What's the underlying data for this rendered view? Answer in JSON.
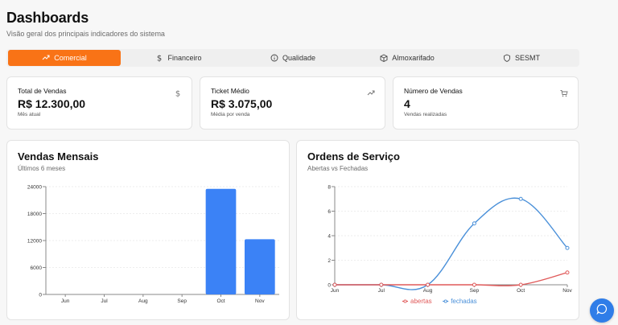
{
  "page": {
    "title": "Dashboards",
    "subtitle": "Visão geral dos principais indicadores do sistema"
  },
  "tabs": [
    {
      "label": "Comercial",
      "icon": "trend-up-icon",
      "active": true
    },
    {
      "label": "Financeiro",
      "icon": "dollar-icon",
      "active": false
    },
    {
      "label": "Qualidade",
      "icon": "info-circle-icon",
      "active": false
    },
    {
      "label": "Almoxarifado",
      "icon": "box-icon",
      "active": false
    },
    {
      "label": "SESMT",
      "icon": "shield-icon",
      "active": false
    }
  ],
  "kpis": [
    {
      "label": "Total de Vendas",
      "value": "R$ 12.300,00",
      "sub": "Mês atual",
      "icon": "dollar-icon"
    },
    {
      "label": "Ticket Médio",
      "value": "R$ 3.075,00",
      "sub": "Média por venda",
      "icon": "trend-up-icon"
    },
    {
      "label": "Número de Vendas",
      "value": "4",
      "sub": "Vendas realizadas",
      "icon": "cart-icon"
    }
  ],
  "colors": {
    "accent": "#f97316",
    "bar": "#3b82f6",
    "line_fechadas": "#4a90d9",
    "line_abertas": "#e05a5a",
    "fab": "#2f7de8"
  },
  "chart_data": [
    {
      "type": "bar",
      "title": "Vendas Mensais",
      "subtitle": "Últimos 6 meses",
      "categories": [
        "Jun",
        "Jul",
        "Aug",
        "Sep",
        "Oct",
        "Nov"
      ],
      "values": [
        0,
        0,
        0,
        0,
        23500,
        12300
      ],
      "ylim": [
        0,
        24000
      ],
      "yticks": [
        0,
        6000,
        12000,
        18000,
        24000
      ],
      "grid": true
    },
    {
      "type": "line",
      "title": "Ordens de Serviço",
      "subtitle": "Abertas vs Fechadas",
      "categories": [
        "Jun",
        "Jul",
        "Aug",
        "Sep",
        "Oct",
        "Nov"
      ],
      "series": [
        {
          "name": "abertas",
          "values": [
            0,
            0,
            0,
            0,
            0,
            1
          ]
        },
        {
          "name": "fechadas",
          "values": [
            0,
            0,
            0,
            5,
            7,
            3
          ]
        }
      ],
      "ylim": [
        0,
        8
      ],
      "yticks": [
        0,
        2,
        4,
        6,
        8
      ],
      "legend": "bottom",
      "grid": true
    }
  ]
}
